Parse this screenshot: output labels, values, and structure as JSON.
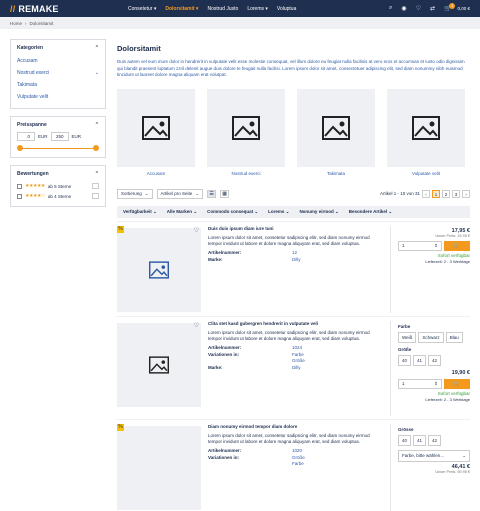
{
  "header": {
    "logo": "REMAKE",
    "nav": [
      "Consetetur",
      "Dolorsitamit",
      "Nostrud Justo",
      "Lorems",
      "Voluptua"
    ],
    "active_nav": 1,
    "cart_count": "1",
    "cart_total": "0,00 €"
  },
  "breadcrumb": [
    "Home",
    "Dolorsitamit"
  ],
  "sidebar": {
    "categories_title": "Kategorien",
    "categories": [
      "Accusam",
      "Nostrud exerci",
      "Takimata",
      "Vulputate velit"
    ],
    "price_title": "Preisspanne",
    "price_min": "0",
    "price_max": "250",
    "currency": "EUR",
    "ratings_title": "Bewertungen",
    "ratings": [
      {
        "stars": "★★★★★",
        "label": "ab 5 Sterne"
      },
      {
        "stars": "★★★★☆",
        "label": "ab 4 Sterne"
      }
    ]
  },
  "main": {
    "title": "Dolorsitamit",
    "intro": "Duis autem vel eum iriure dolor in hendrerit in vulputate velit esse molestie consequat, vel illum dolore eu feugiat nulla facilisis at vero eros et accumsan et iusto odio dignissim qui blandit praesent luptatum zzril delenit augue duis dolore te feugait nulla facilisi. Lorem ipsum dolor sit amet, consectetuer adipiscing elit, sed diam nonummy nibh euismod tincidunt ut laoreet dolore magna aliquam erat volutpat.",
    "categories": [
      "Accusam",
      "Nostrud exerci",
      "Takimata",
      "Vulputate velit"
    ],
    "sort_label": "Sortierung",
    "per_page_label": "Artikel pro Seite",
    "result_text": "Artikel 1 - 10 von 31",
    "pages": [
      "1",
      "2",
      "3"
    ],
    "filters": [
      "Verfügbarkeit",
      "Alle Marken",
      "Commodo consequat",
      "Lorems",
      "Nonumy eirmod",
      "Besondere Artikel"
    ]
  },
  "products": [
    {
      "name": "Duis duis ipsum diam iure tuni",
      "desc": "Lorem ipsum dolor sit amet, consetetur sadipscing elitr, sed diam nonumy eirmod tempor invidunt ut labore et dolore magna aliquyam erat, sed diam voluptua.",
      "attrs": [
        {
          "k": "Artikelnummer:",
          "v": "12"
        },
        {
          "k": "Marke:",
          "v": "Dilly"
        }
      ],
      "price": "17,95 €",
      "uvp": "Unser Preis: 19,95 €",
      "qty": "1",
      "avail": "Sofort verfügbar",
      "delivery": "Lieferzeit: 2 - 3 Werktage"
    },
    {
      "name": "Clita stet kasd gubergren hendrerit in vulputate veli",
      "desc": "Lorem ipsum dolor sit amet, consetetur sadipscing elitr, sed diam nonumy eirmod tempor invidunt ut labore et dolore magna aliquyam erat, sed diam voluptua.",
      "attrs": [
        {
          "k": "Artikelnummer:",
          "v": "1024"
        },
        {
          "k": "Variationen in:",
          "v": "Farbe\nGröße"
        },
        {
          "k": "Marke:",
          "v": "Dilly"
        }
      ],
      "color_label": "Farbe",
      "colors": [
        "Weiß",
        "Schwarz",
        "Blau"
      ],
      "size_label": "Größe",
      "sizes": [
        "40",
        "41",
        "42"
      ],
      "price": "19,90 €",
      "qty": "1",
      "avail": "Sofort verfügbar",
      "delivery": "Lieferzeit: 2 - 3 Werktage"
    },
    {
      "name": "Diam nonumy eirmod tempor diam dolore",
      "desc": "Lorem ipsum dolor sit amet, consetetur sadipscing elitr, sed diam nonumy eirmod tempor invidunt ut labore et dolore magna aliquyam erat, sed diam voluptua.",
      "attrs": [
        {
          "k": "Artikelnummer:",
          "v": "1020"
        },
        {
          "k": "Variationen in:",
          "v": "Größe\nFarbe"
        }
      ],
      "size_label": "Grösse",
      "sizes": [
        "40",
        "41",
        "42"
      ],
      "select_placeholder": "Farbe, bitte wählen...",
      "price": "46,41 €",
      "uvp": "Unser Preis: 59,95 €"
    }
  ],
  "colors": {
    "navy": "#1f2f50",
    "accent": "#f39a1e",
    "link": "#2e5aa5"
  }
}
